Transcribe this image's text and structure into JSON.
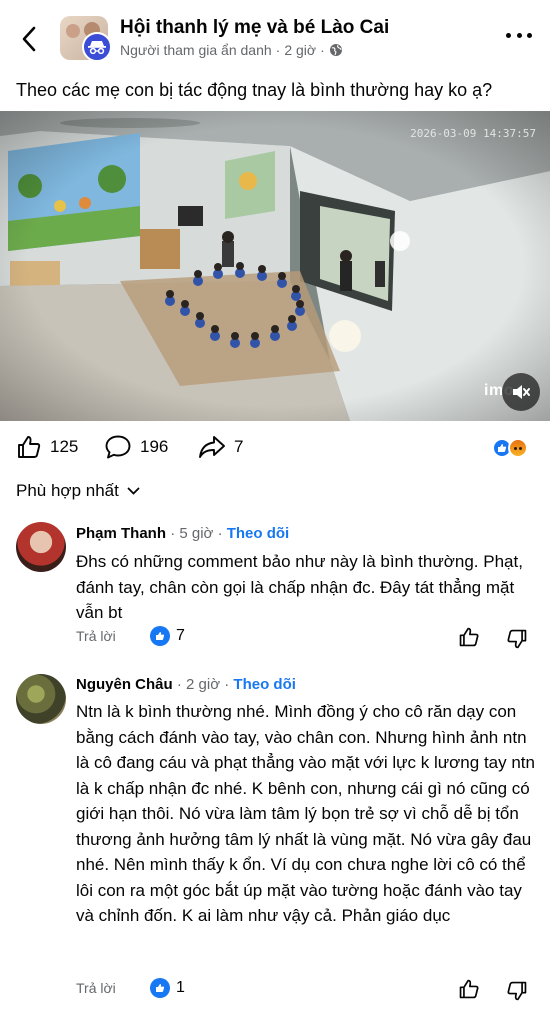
{
  "header": {
    "group_name": "Hội thanh lý mẹ và bé Lào Cai",
    "author": "Người tham gia ẩn danh",
    "separator": "·",
    "time": "2 giờ"
  },
  "post": {
    "text": "Theo các mẹ con bị tác động tnay là bình thường hay ko ạ?",
    "image": {
      "timestamp": "2026-03-09 14:37:57",
      "brand": "imo"
    }
  },
  "stats": {
    "likes": "125",
    "comments": "196",
    "shares": "7"
  },
  "sort": {
    "label": "Phù hợp nhất"
  },
  "comments": [
    {
      "name": "Phạm Thanh",
      "time": "5 giờ",
      "follow": "Theo dõi",
      "text": "Đhs có những comment bảo như này là bình thường. Phạt, đánh tay, chân còn gọi là chấp nhận đc. Đây tát thẳng mặt vẫn bt",
      "reply": "Trả lời",
      "reactions": "7"
    },
    {
      "name": "Nguyên Châu",
      "time": "2 giờ",
      "follow": "Theo dõi",
      "text": "Ntn là k bình thường nhé.  Mình đồng ý cho cô răn dạy con bằng cách đánh vào tay, vào chân con. Nhưng hình ảnh ntn là cô đang cáu và phạt thẳng vào mặt với lực k lương tay ntn là k chấp nhận đc nhé.  K bênh con, nhưng cái gì nó cũng có giới hạn thôi.  Nó vừa làm tâm lý bọn trẻ sợ vì chỗ dễ bị tổn thương ảnh hưởng tâm lý nhất là vùng mặt.  Nó vừa gây đau nhé. Nên mình thấy k ổn.  Ví dụ con chưa nghe lời cô có thể lôi con ra một góc bắt úp mặt vào tường hoặc đánh vào tay và chỉnh đốn.  K ai làm như vậy cả. Phản giáo dục",
      "reply": "Trả lời",
      "reactions": "1"
    }
  ],
  "colors": {
    "primary": "#1877f2",
    "text": "#050505",
    "secondary_text": "#65676b",
    "anon_badge": "#3b4cd6"
  }
}
